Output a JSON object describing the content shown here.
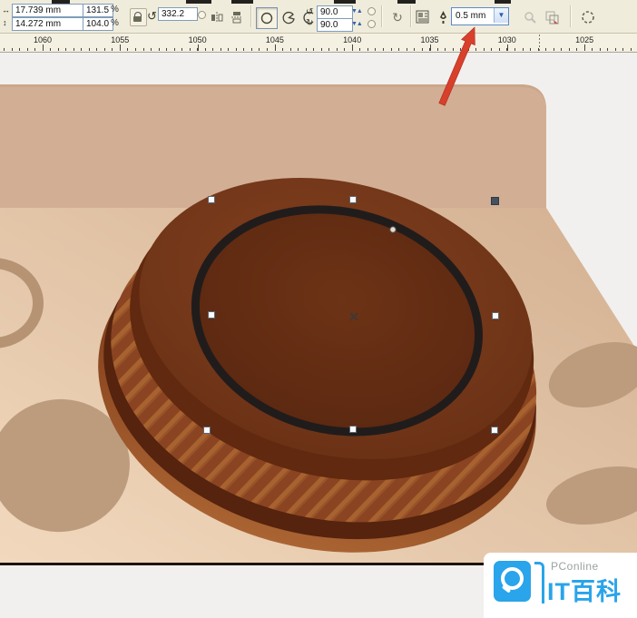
{
  "toolbar": {
    "object_size": {
      "width": "17.739 mm",
      "height": "14.272 mm"
    },
    "scale": {
      "x": "131.5",
      "y": "104.0",
      "percent": "%"
    },
    "rotation": {
      "value": "332.2"
    },
    "ellipse_angles": {
      "start": "90.0",
      "end": "90.0"
    },
    "outline_width": {
      "value": "0.5 mm",
      "chevron": "▼"
    }
  },
  "ruler": {
    "labels": [
      "1060",
      "1055",
      "1050",
      "1045",
      "1040",
      "1035",
      "1030",
      "1025"
    ]
  },
  "watermark": {
    "brand": "PConline",
    "title": "IT百科"
  },
  "colors": {
    "accent_blue": "#2aa4ea",
    "arrow_red": "#d8402c",
    "cap_brown": "#6b3115",
    "table_tan": "#e3c7ab",
    "spot_tan": "#bd9c7e"
  }
}
